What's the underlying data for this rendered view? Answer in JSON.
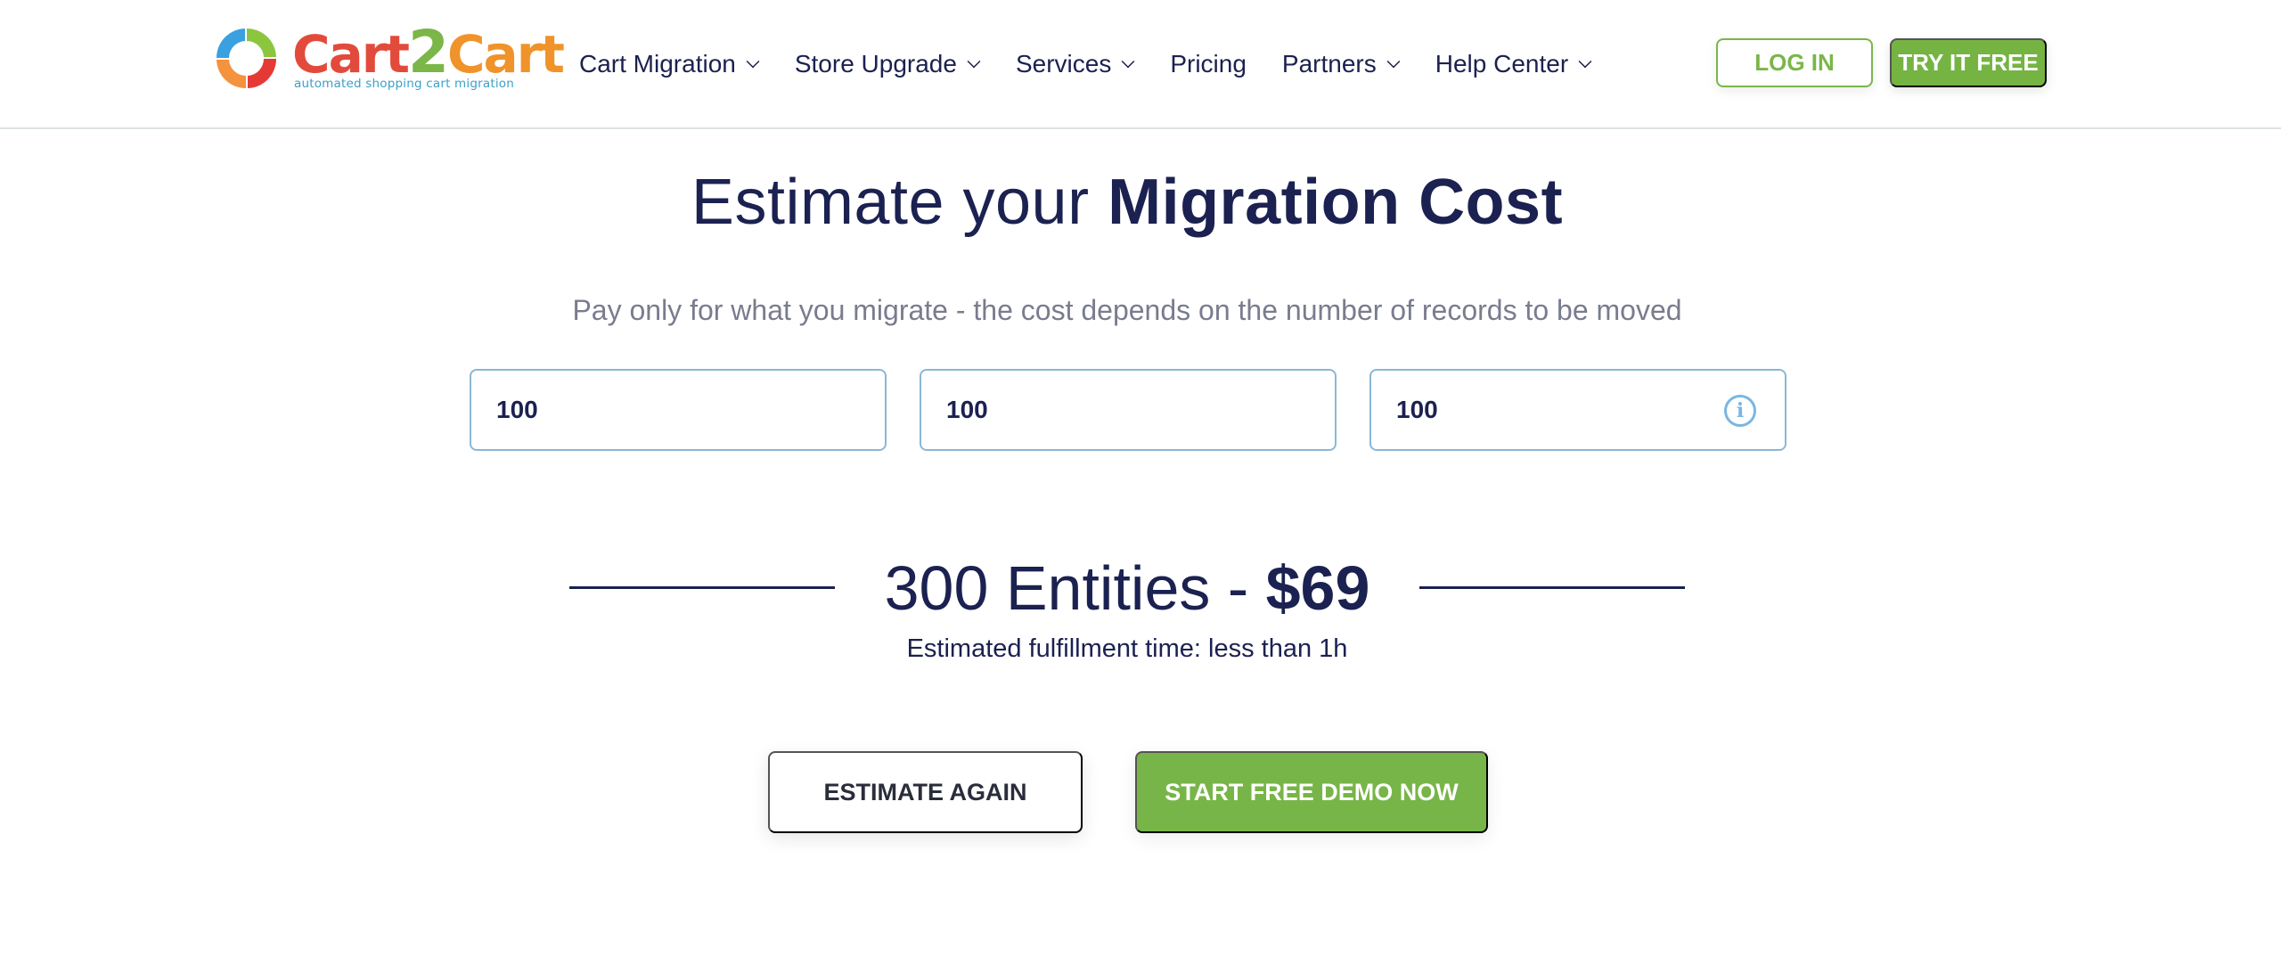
{
  "header": {
    "logo": {
      "word_part1": "Cart",
      "word_part2": "2",
      "word_part3": "Cart",
      "tagline": "automated shopping cart migration"
    },
    "nav": [
      {
        "label": "Cart Migration",
        "has_dropdown": true
      },
      {
        "label": "Store Upgrade",
        "has_dropdown": true
      },
      {
        "label": "Services",
        "has_dropdown": true
      },
      {
        "label": "Pricing",
        "has_dropdown": false
      },
      {
        "label": "Partners",
        "has_dropdown": true
      },
      {
        "label": "Help Center",
        "has_dropdown": true
      }
    ],
    "login_label": "LOG IN",
    "try_label": "TRY IT FREE"
  },
  "main": {
    "title_light": "Estimate your ",
    "title_bold": "Migration Cost",
    "subtitle": "Pay only for what you migrate - the cost depends on the number of records to be moved",
    "inputs": [
      {
        "value": "100"
      },
      {
        "value": "100"
      },
      {
        "value": "100",
        "icon": "info-icon"
      }
    ],
    "result_entities": "300 Entities - ",
    "result_price": "$69",
    "fulfillment": "Estimated fulfillment time: less than 1h",
    "estimate_again_label": "ESTIMATE AGAIN",
    "start_demo_label": "START FREE DEMO NOW"
  },
  "colors": {
    "brand_green": "#75b443",
    "navy_text": "#1b2150",
    "input_border": "#8ab7d6",
    "info_icon": "#7ab7e2",
    "logo_red": "#e24b3b",
    "logo_orange": "#f0932b"
  }
}
